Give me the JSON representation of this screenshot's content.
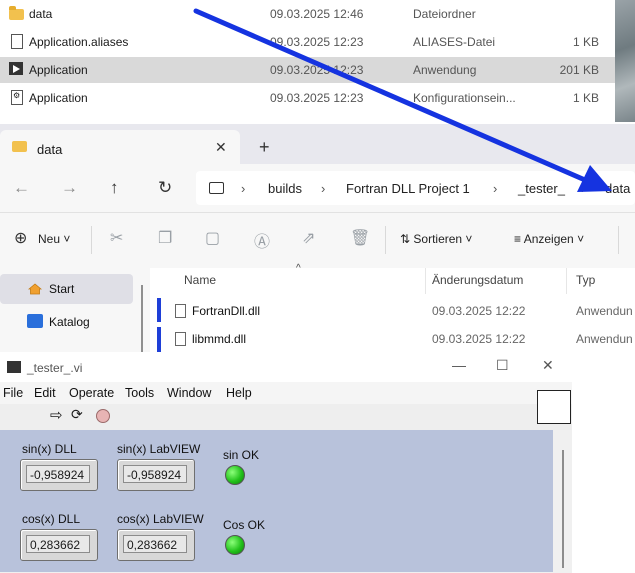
{
  "top_list": {
    "rows": [
      {
        "name": "data",
        "date": "09.03.2025 12:46",
        "type": "Dateiordner",
        "size": "",
        "icon": "folder-icon"
      },
      {
        "name": "Application.aliases",
        "date": "09.03.2025 12:23",
        "type": "ALIASES-Datei",
        "size": "1 KB",
        "icon": "file-icon"
      },
      {
        "name": "Application",
        "date": "09.03.2025 12:23",
        "type": "Anwendung",
        "size": "201 KB",
        "icon": "application-icon"
      },
      {
        "name": "Application",
        "date": "09.03.2025 12:23",
        "type": "Konfigurationsein...",
        "size": "1 KB",
        "icon": "config-file-icon"
      }
    ]
  },
  "explorer": {
    "tab_label": "data",
    "tab_close": "✕",
    "tab_new": "+",
    "nav": {
      "back": "←",
      "forward": "→",
      "up": "↑",
      "refresh": "↻"
    },
    "breadcrumbs": [
      "builds",
      "Fortran DLL Project 1",
      "_tester_",
      "data"
    ],
    "toolbar": {
      "new": "Neu",
      "sort": "Sortieren",
      "view": "Anzeigen"
    },
    "nav_pane": {
      "items": [
        "Start",
        "Katalog"
      ]
    },
    "columns": {
      "name": "Name",
      "date": "Änderungsdatum",
      "type": "Typ"
    },
    "files": [
      {
        "name": "FortranDll.dll",
        "date": "09.03.2025 12:22",
        "type": "Anwendun"
      },
      {
        "name": "libmmd.dll",
        "date": "09.03.2025 12:22",
        "type": "Anwendun"
      }
    ]
  },
  "labview": {
    "title": "_tester_.vi",
    "menu": [
      "File",
      "Edit",
      "Operate",
      "Tools",
      "Window",
      "Help"
    ],
    "controls": {
      "sin_dll_label": "sin(x) DLL",
      "sin_dll_value": "-0,958924",
      "sin_lv_label": "sin(x) LabVIEW",
      "sin_lv_value": "-0,958924",
      "sin_ok_label": "sin OK",
      "cos_dll_label": "cos(x) DLL",
      "cos_dll_value": "0,283662",
      "cos_lv_label": "cos(x) LabVIEW",
      "cos_lv_value": "0,283662",
      "cos_ok_label": "Cos OK"
    }
  },
  "colors": {
    "accent_arrow": "#1533e0",
    "led_on": "#22c21b",
    "panel_bg": "#b8c2db",
    "selection": "#d9d9d9"
  }
}
